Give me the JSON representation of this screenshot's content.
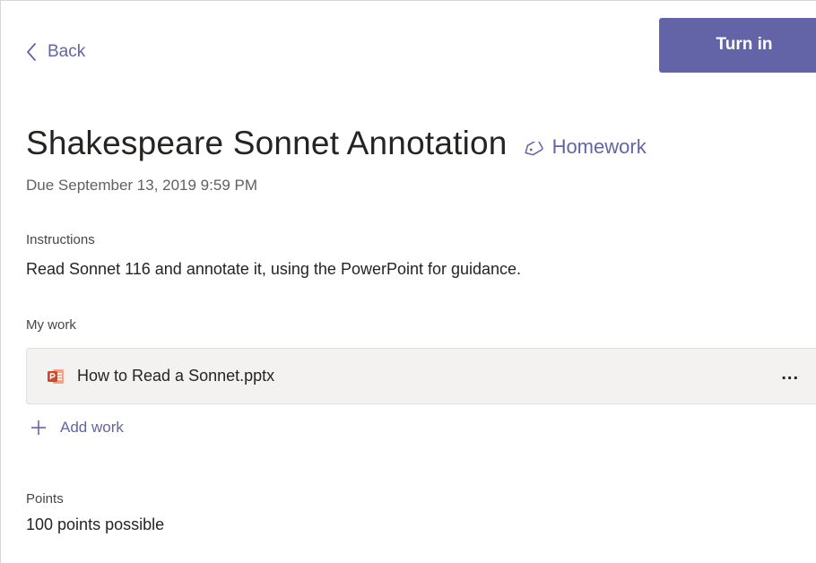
{
  "header": {
    "back_label": "Back",
    "turn_in_label": "Turn in"
  },
  "assignment": {
    "title": "Shakespeare Sonnet Annotation",
    "category": "Homework",
    "due": "Due September 13, 2019 9:59 PM"
  },
  "instructions": {
    "label": "Instructions",
    "text": "Read Sonnet 116 and annotate it, using the PowerPoint for guidance."
  },
  "my_work": {
    "label": "My work",
    "files": [
      {
        "name": "How to Read a Sonnet.pptx",
        "icon": "powerpoint-file-icon",
        "more_label": "..."
      }
    ],
    "add_label": "Add work"
  },
  "points": {
    "label": "Points",
    "text": "100 points possible"
  },
  "colors": {
    "accent": "#6264a7",
    "powerpoint": "#d24726"
  }
}
